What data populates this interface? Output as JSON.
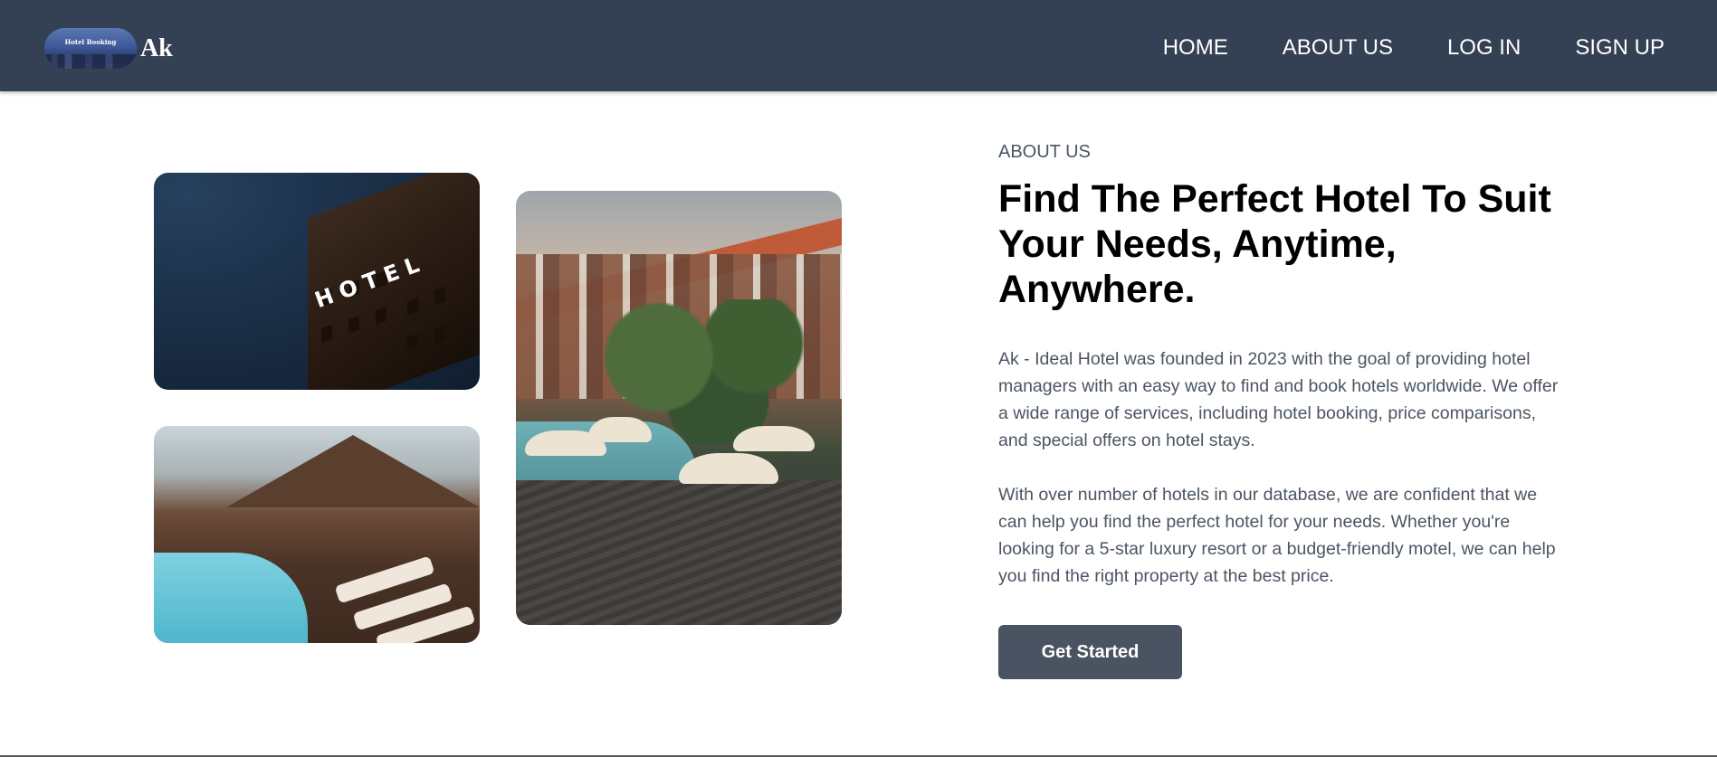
{
  "navbar": {
    "logo_text": "Hotel Booking",
    "brand_name": "Ak",
    "links": [
      "HOME",
      "ABOUT US",
      "LOG IN",
      "SIGN UP"
    ]
  },
  "images": {
    "hotel_sign_text": "HOTEL"
  },
  "about": {
    "label": "ABOUT US",
    "headline": "Find The Perfect Hotel To Suit Your Needs, Anytime, Anywhere.",
    "paragraph_1": "Ak - Ideal Hotel was founded in 2023 with the goal of providing hotel managers with an easy way to find and book hotels worldwide. We offer a wide range of services, including hotel booking, price comparisons, and special offers on hotel stays.",
    "paragraph_2": "With over number of hotels in our database, we are confident that we can help you find the perfect hotel for your needs. Whether you're looking for a 5-star luxury resort or a budget-friendly motel, we can help you find the right property at the best price.",
    "cta_label": "Get Started"
  },
  "colors": {
    "navbar_bg": "#344154",
    "button_bg": "#4a5361",
    "body_text": "#4b5563"
  }
}
